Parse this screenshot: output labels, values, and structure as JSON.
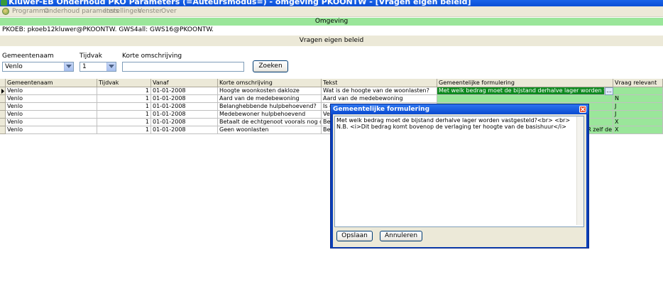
{
  "window": {
    "title": "Kluwer-EB Onderhoud PKO Parameters (=Auteursmodus=) - omgeving PKOONTW - [Vragen eigen beleid]"
  },
  "menu": {
    "items": [
      "Programma",
      "Onderhoud parameters",
      "Instellingen",
      "Venster",
      "Over"
    ]
  },
  "omgeving": {
    "header": "Omgeving",
    "line": "PKOEB: pkoeb12kluwer@PKOONTW. GWS4all: GWS16@PKOONTW."
  },
  "section": {
    "title": "Vragen eigen beleid"
  },
  "filters": {
    "gemeentenaam_label": "Gemeentenaam",
    "gemeentenaam_value": "Venlo",
    "tijdvak_label": "Tijdvak",
    "tijdvak_value": "1",
    "korte_label": "Korte omschrijving",
    "korte_value": "",
    "zoeken_label": "Zoeken"
  },
  "grid": {
    "columns": [
      "Gemeentenaam",
      "Tijdvak",
      "Vanaf",
      "Korte omschrijving",
      "Tekst",
      "Gemeentelijke formulering",
      "Vraag relevant"
    ],
    "rows": [
      {
        "gemeente": "Venlo",
        "tijdvak": "1",
        "vanaf": "01-01-2008",
        "korte": "Hoogte woonkosten dakloze",
        "tekst": "Wat is de hoogte van de woonlasten?",
        "formulering": "Met welk bedrag moet de bijstand derhalve lager worden vastgesteld?<b",
        "relevant": ""
      },
      {
        "gemeente": "Venlo",
        "tijdvak": "1",
        "vanaf": "01-01-2008",
        "korte": "Aard van de medebewoning",
        "tekst": "Aard van de medebewoning",
        "formulering": "",
        "relevant": "N"
      },
      {
        "gemeente": "Venlo",
        "tijdvak": "1",
        "vanaf": "01-01-2008",
        "korte": "Belanghebbende hulpbehoevend?",
        "tekst": "Is d",
        "formulering": "",
        "relevant": "J"
      },
      {
        "gemeente": "Venlo",
        "tijdvak": "1",
        "vanaf": "01-01-2008",
        "korte": "Medebewoner hulpbehoevend",
        "tekst": "Ve",
        "formulering": "",
        "relevant": "J"
      },
      {
        "gemeente": "Venlo",
        "tijdvak": "1",
        "vanaf": "01-01-2008",
        "korte": "Betaalt de echtgenoot voorals nog de woonk",
        "tekst": "Be",
        "formulering": "",
        "relevant": "X"
      },
      {
        "gemeente": "Venlo",
        "tijdvak": "1",
        "vanaf": "01-01-2008",
        "korte": "Geen woonlasten",
        "tekst": "Be",
        "formulering": "IER zelf de",
        "relevant": "X"
      }
    ]
  },
  "dialog": {
    "title": "Gemeentelijke formulering",
    "text": "Met welk bedrag moet de bijstand derhalve lager worden vastgesteld?<br> <br>\nN.B. <i>Dit bedrag komt bovenop de verlaging ter hoogte van de basishuur</i>",
    "ok_label": "Opslaan",
    "cancel_label": "Annuleren"
  },
  "colors": {
    "section_green": "#9ae69a",
    "selected_green": "#0f8a20",
    "title_blue": "#0a4fd6"
  },
  "icons": {
    "app": "app-logo-icon",
    "combo": "chevron-down-icon",
    "row_pointer": "row-pointer-icon",
    "ellipsis": "ellipsis-button-icon",
    "close": "close-icon"
  }
}
